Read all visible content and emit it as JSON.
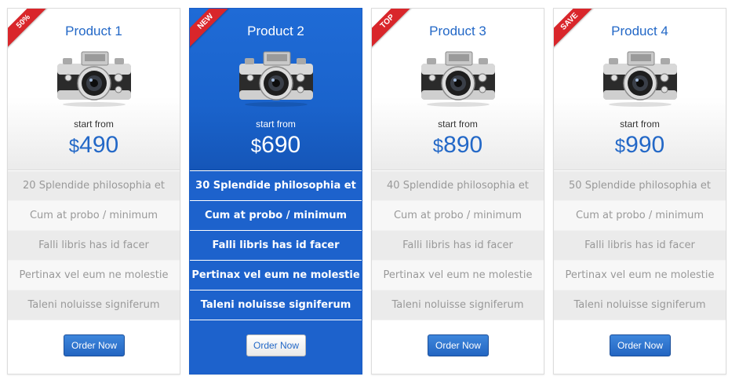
{
  "colors": {
    "accent": "#2368c7",
    "featured_bg": "#1d62cc",
    "ribbon": "#d9262b"
  },
  "products": [
    {
      "title": "Product 1",
      "ribbon": "50%",
      "start_label": "start from",
      "currency": "$",
      "amount": "490",
      "features": [
        "20 Splendide philosophia et",
        "Cum at probo / minimum",
        "Falli libris has id facer",
        "Pertinax vel eum ne molestie",
        "Taleni noluisse signiferum"
      ],
      "button": "Order Now",
      "icon": "camera-icon"
    },
    {
      "title": "Product 2",
      "ribbon": "NEW",
      "start_label": "start from",
      "currency": "$",
      "amount": "690",
      "features": [
        "30 Splendide philosophia et",
        "Cum at probo / minimum",
        "Falli libris has id facer",
        "Pertinax vel eum ne molestie",
        "Taleni noluisse signiferum"
      ],
      "button": "Order Now",
      "icon": "camera-icon"
    },
    {
      "title": "Product 3",
      "ribbon": "TOP",
      "start_label": "start from",
      "currency": "$",
      "amount": "890",
      "features": [
        "40 Splendide philosophia et",
        "Cum at probo / minimum",
        "Falli libris has id facer",
        "Pertinax vel eum ne molestie",
        "Taleni noluisse signiferum"
      ],
      "button": "Order Now",
      "icon": "camera-icon"
    },
    {
      "title": "Product 4",
      "ribbon": "SAVE",
      "start_label": "start from",
      "currency": "$",
      "amount": "990",
      "features": [
        "50 Splendide philosophia et",
        "Cum at probo / minimum",
        "Falli libris has id facer",
        "Pertinax vel eum ne molestie",
        "Taleni noluisse signiferum"
      ],
      "button": "Order Now",
      "icon": "camera-icon"
    }
  ]
}
